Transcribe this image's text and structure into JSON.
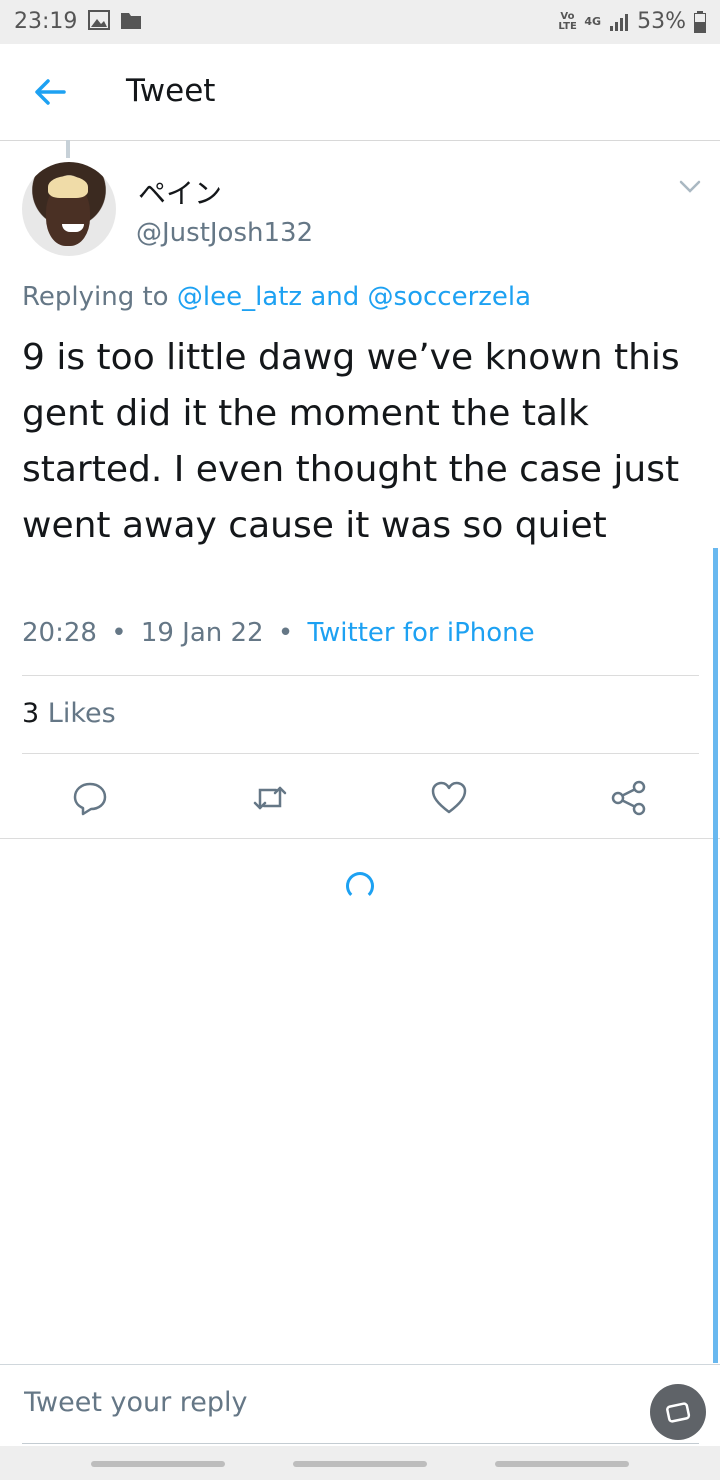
{
  "status_bar": {
    "time": "23:19",
    "network_label": "Vo LTE",
    "network_type": "4G",
    "battery": "53%"
  },
  "app_bar": {
    "title": "Tweet"
  },
  "tweet": {
    "display_name": "ペイン",
    "handle": "@JustJosh132",
    "replying_prefix": "Replying to",
    "mention_1": "@lee_latz",
    "replying_and": "and",
    "mention_2": "@soccerzela",
    "text": "9 is too little dawg we’ve known this gent did it the moment the talk started. I even thought the case just went away cause it was so quiet",
    "time": "20:28",
    "date": "19 Jan 22",
    "separator": "•",
    "source": "Twitter for iPhone",
    "likes_count": "3",
    "likes_label": "Likes"
  },
  "reply": {
    "placeholder": "Tweet your reply"
  },
  "colors": {
    "accent": "#1da1f2",
    "secondary_text": "#657786",
    "primary_text": "#14171a"
  }
}
